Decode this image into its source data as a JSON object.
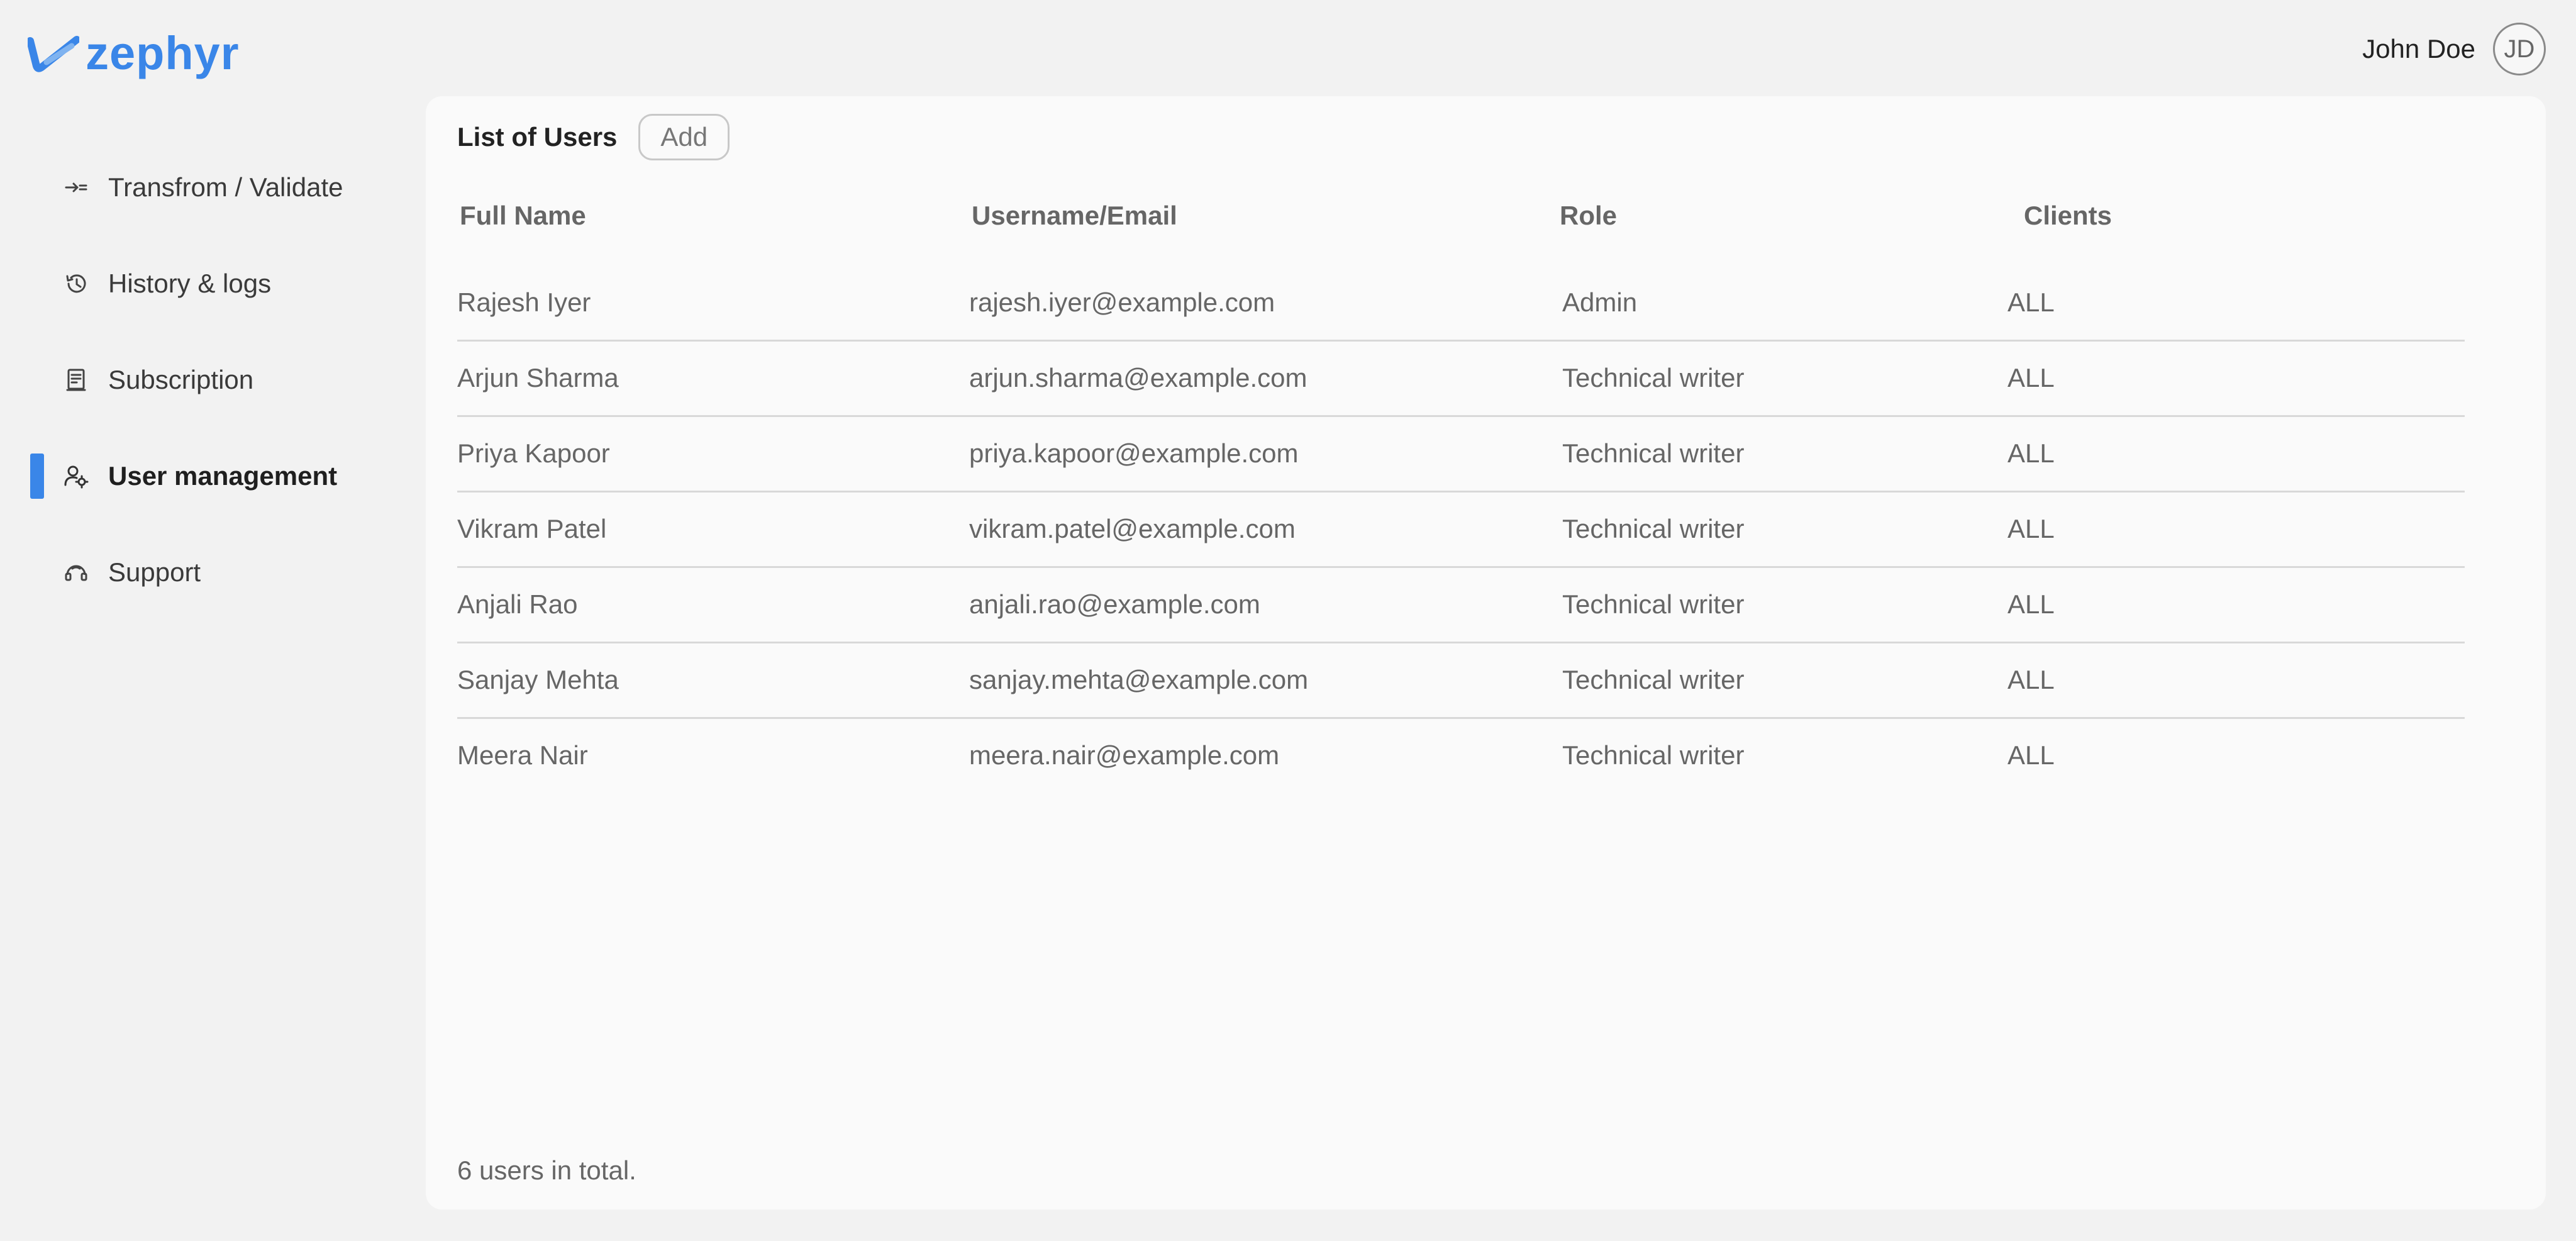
{
  "app": {
    "logo_text": "zephyr",
    "brand_color": "#3a86e8"
  },
  "user": {
    "name": "John Doe",
    "initials": "JD"
  },
  "sidebar": {
    "items": [
      {
        "label": "Transfrom / Validate",
        "icon": "transform-icon",
        "active": false
      },
      {
        "label": "History & logs",
        "icon": "history-icon",
        "active": false
      },
      {
        "label": "Subscription",
        "icon": "subscription-icon",
        "active": false
      },
      {
        "label": "User management",
        "icon": "user-management-icon",
        "active": true
      },
      {
        "label": "Support",
        "icon": "support-icon",
        "active": false
      }
    ]
  },
  "main": {
    "title": "List of Users",
    "add_label": "Add",
    "columns": [
      "Full Name",
      "Username/Email",
      "Role",
      "Clients"
    ],
    "rows": [
      {
        "name": "Rajesh Iyer",
        "email": "rajesh.iyer@example.com",
        "role": "Admin",
        "clients": "ALL"
      },
      {
        "name": "Arjun Sharma",
        "email": "arjun.sharma@example.com",
        "role": "Technical writer",
        "clients": "ALL"
      },
      {
        "name": "Priya Kapoor",
        "email": "priya.kapoor@example.com",
        "role": "Technical writer",
        "clients": "ALL"
      },
      {
        "name": "Vikram Patel",
        "email": "vikram.patel@example.com",
        "role": "Technical writer",
        "clients": "ALL"
      },
      {
        "name": "Anjali Rao",
        "email": "anjali.rao@example.com",
        "role": "Technical writer",
        "clients": "ALL"
      },
      {
        "name": "Sanjay Mehta",
        "email": "sanjay.mehta@example.com",
        "role": "Technical writer",
        "clients": "ALL"
      },
      {
        "name": "Meera Nair",
        "email": "meera.nair@example.com",
        "role": "Technical writer",
        "clients": "ALL"
      }
    ],
    "total_text": "6 users in total."
  }
}
